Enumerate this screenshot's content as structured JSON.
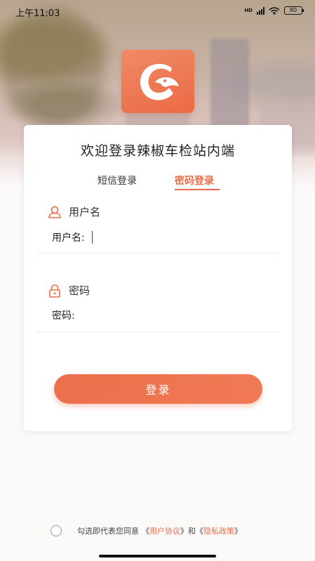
{
  "status_bar": {
    "time": "上午11:03",
    "network": "HD",
    "battery": "80"
  },
  "app": {
    "title": "欢迎登录辣椒车检站内端"
  },
  "tabs": [
    {
      "label": "短信登录",
      "active": false
    },
    {
      "label": "密码登录",
      "active": true
    }
  ],
  "username": {
    "section_label": "用户名",
    "input_label": "用户名:",
    "value": ""
  },
  "password": {
    "section_label": "密码",
    "input_label": "密码:",
    "value": ""
  },
  "login_button": "登录",
  "agreement": {
    "prefix": "勾选即代表您同意",
    "open1": "《",
    "link1": "用户协议",
    "close1": "》",
    "and": "和",
    "open2": "《",
    "link2": "隐私政策",
    "close2": "》",
    "checked": false
  },
  "colors": {
    "accent": "#e96c47",
    "button": "#ec6f4b",
    "logo": "#ee7a55"
  },
  "icons": [
    "hd-icon",
    "signal-icon",
    "wifi-icon",
    "battery-icon",
    "app-logo-icon",
    "user-icon",
    "lock-icon"
  ]
}
